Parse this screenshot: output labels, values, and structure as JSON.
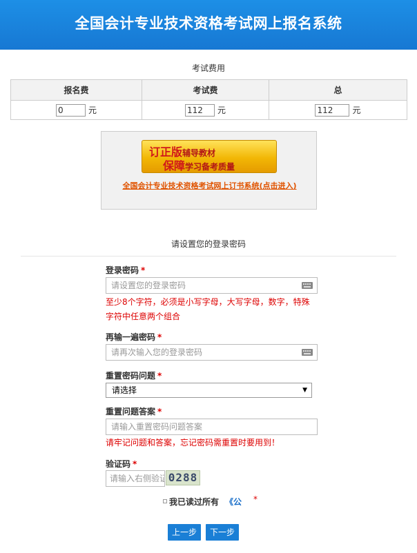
{
  "header": {
    "title": "全国会计专业技术资格考试网上报名系统"
  },
  "fees": {
    "caption": "考试费用",
    "columns": [
      "报名费",
      "考试费",
      "总"
    ],
    "values": [
      "0",
      "112",
      "112"
    ],
    "unit": "元"
  },
  "ad": {
    "line1_big": "订正版",
    "line1_small": "辅导教材",
    "line2_big": "保障",
    "line2_small": "学习备考质量",
    "link": "全国会计专业技术资格考试网上订书系统(点击进入)"
  },
  "password_section": {
    "caption": "请设置您的登录密码"
  },
  "form": {
    "required_mark": "*",
    "password_label": "登录密码",
    "password_placeholder": "请设置您的登录密码",
    "password_hint": "至少8个字符，必须是小写字母，大写字母，数字，特殊字符中任意两个组合",
    "confirm_label": "再输一遍密码",
    "confirm_placeholder": "请再次输入您的登录密码",
    "question_label": "重置密码问题",
    "question_selected": "请选择",
    "answer_label": "重置问题答案",
    "answer_placeholder": "请输入重置密码问题答案",
    "answer_hint": "请牢记问题和答案，忘记密码需重置时要用到！",
    "captcha_label": "验证码",
    "captcha_placeholder": "请输入右侧验证码",
    "captcha_code": "0288",
    "agree_text": "我已读过所有",
    "agree_link": "《公"
  },
  "buttons": {
    "prev": "上一步",
    "next": "下一步"
  }
}
